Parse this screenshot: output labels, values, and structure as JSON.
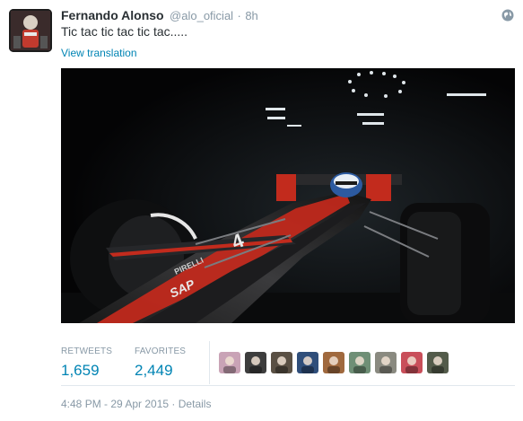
{
  "tweet": {
    "author_name": "Fernando Alonso",
    "handle": "@alo_oficial",
    "separator": "·",
    "age": "8h",
    "text": "Tic tac tic tac tic tac.....",
    "translate_label": "View translation"
  },
  "stats": {
    "retweets_label": "RETWEETS",
    "retweets_count": "1,659",
    "favorites_label": "FAVORITES",
    "favorites_count": "2,449"
  },
  "footer": {
    "timestamp": "4:48 PM - 29 Apr 2015",
    "separator": "·",
    "details_label": "Details"
  },
  "media": {
    "car_number": "4",
    "sponsor_text": "SAP",
    "tyre_text": "PIRELLI",
    "icon": "race-car-photo"
  },
  "favoriters": [
    {
      "icon": "favoriter-avatar-1",
      "color": "#c9a3b6"
    },
    {
      "icon": "favoriter-avatar-2",
      "color": "#3d3d3d"
    },
    {
      "icon": "favoriter-avatar-3",
      "color": "#5a5044"
    },
    {
      "icon": "favoriter-avatar-4",
      "color": "#2f4e7a"
    },
    {
      "icon": "favoriter-avatar-5",
      "color": "#a0693e"
    },
    {
      "icon": "favoriter-avatar-6",
      "color": "#6f8f76"
    },
    {
      "icon": "favoriter-avatar-7",
      "color": "#8a8a80"
    },
    {
      "icon": "favoriter-avatar-8",
      "color": "#c94f5a"
    },
    {
      "icon": "favoriter-avatar-9",
      "color": "#535b4a"
    }
  ],
  "colors": {
    "link": "#0084b4",
    "muted": "#8899a6",
    "text": "#292f33",
    "divider": "#e1e8ed"
  }
}
